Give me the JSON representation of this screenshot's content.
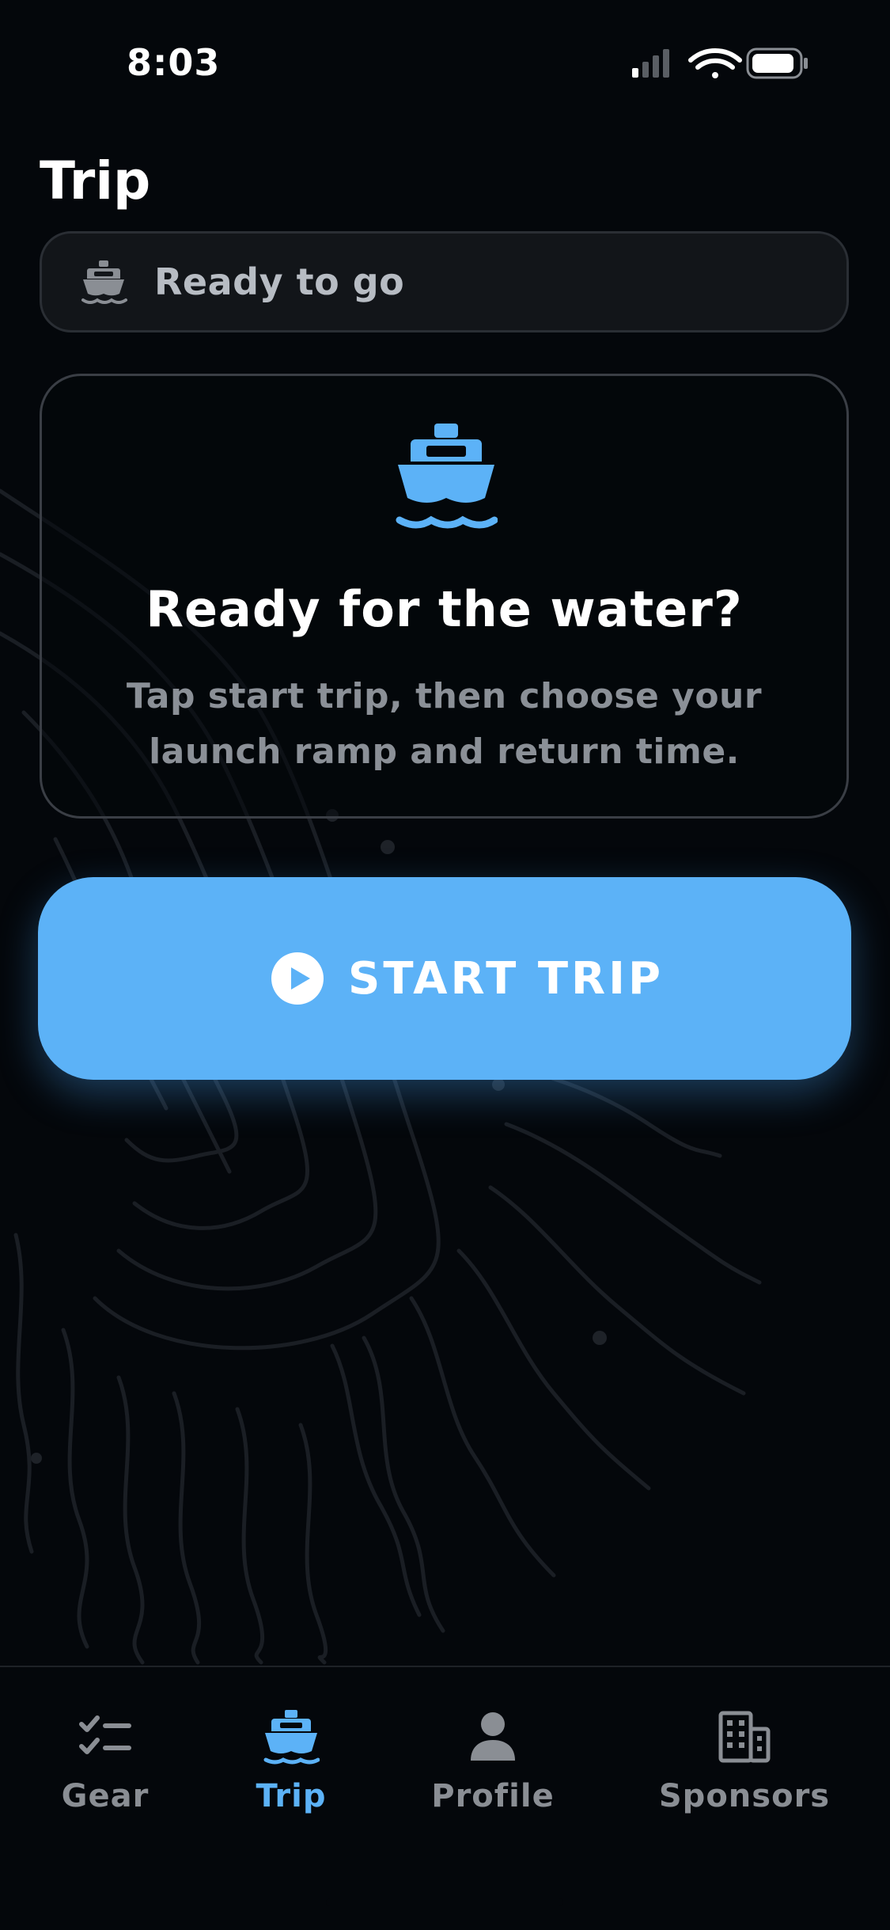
{
  "status_bar": {
    "time": "8:03",
    "icons": [
      "cellular-signal-icon",
      "wifi-icon",
      "battery-icon"
    ]
  },
  "header": {
    "title": "Trip"
  },
  "trip_status": {
    "icon": "ship-icon",
    "text": "Ready to go"
  },
  "intro_card": {
    "icon": "ship-icon",
    "title": "Ready for the water?",
    "body": "Tap start trip, then choose your launch ramp and return time."
  },
  "start_button": {
    "icon": "play-circle-icon",
    "label": "START TRIP"
  },
  "tabs": [
    {
      "label": "Gear",
      "icon": "checklist-icon",
      "active": false
    },
    {
      "label": "Trip",
      "icon": "ship-icon",
      "active": true
    },
    {
      "label": "Profile",
      "icon": "person-icon",
      "active": false
    },
    {
      "label": "Sponsors",
      "icon": "building-icon",
      "active": false
    }
  ],
  "colors": {
    "background": "#04070b",
    "accent": "#5cb2f7",
    "muted_text": "#8a8e94",
    "card_border": "#3a3e45"
  }
}
